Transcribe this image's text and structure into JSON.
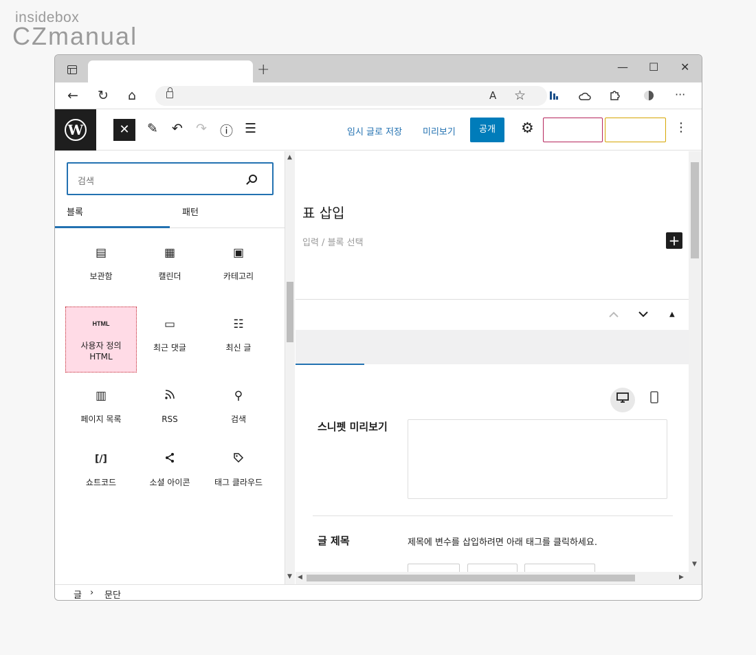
{
  "watermark": {
    "top": "insidebox",
    "bottom": "CZmanual"
  },
  "browser": {
    "new_tab": "+",
    "minimize": "—",
    "maximize": "☐",
    "close": "✕",
    "back": "←",
    "reload": "↻",
    "home": "⌂",
    "read_aloud": "A",
    "favorite": "☆",
    "more": "···"
  },
  "toolbar": {
    "save_draft": "임시 글로 저장",
    "preview": "미리보기",
    "publish": "공개",
    "close": "✕",
    "edit": "✎",
    "undo": "↶",
    "redo": "↷",
    "info": "ⓘ",
    "list": "☰",
    "settings": "⚙",
    "options": "⋮"
  },
  "inserter": {
    "search_placeholder": "검색",
    "tabs": [
      "블록",
      "패턴"
    ],
    "blocks": [
      {
        "label": "보관함",
        "icon": "▤"
      },
      {
        "label": "캘린더",
        "icon": "▦"
      },
      {
        "label": "카테고리",
        "icon": "▣"
      },
      {
        "label": "사용자 정의 HTML",
        "icon": "HTML"
      },
      {
        "label": "최근 댓글",
        "icon": "▭"
      },
      {
        "label": "최신 글",
        "icon": "☷"
      },
      {
        "label": "페이지 목록",
        "icon": "▥"
      },
      {
        "label": "RSS",
        "icon": "⌘"
      },
      {
        "label": "검색",
        "icon": "⚲"
      },
      {
        "label": "쇼트코드",
        "icon": "[/]"
      },
      {
        "label": "소셜 아이콘",
        "icon": "⮌"
      },
      {
        "label": "태그 클라우드",
        "icon": "◇"
      }
    ]
  },
  "editor": {
    "title": "표 삽입",
    "hint": "입력 / 블록 선택",
    "add": "+",
    "snippet_label": "스니펫 미리보기",
    "post_title_label": "글 제목",
    "post_title_desc": "제목에 변수를 삽입하려면 아래 태그를 클릭하세요."
  },
  "footer": {
    "crumb1": "글",
    "sep": "›",
    "crumb2": "문단"
  }
}
